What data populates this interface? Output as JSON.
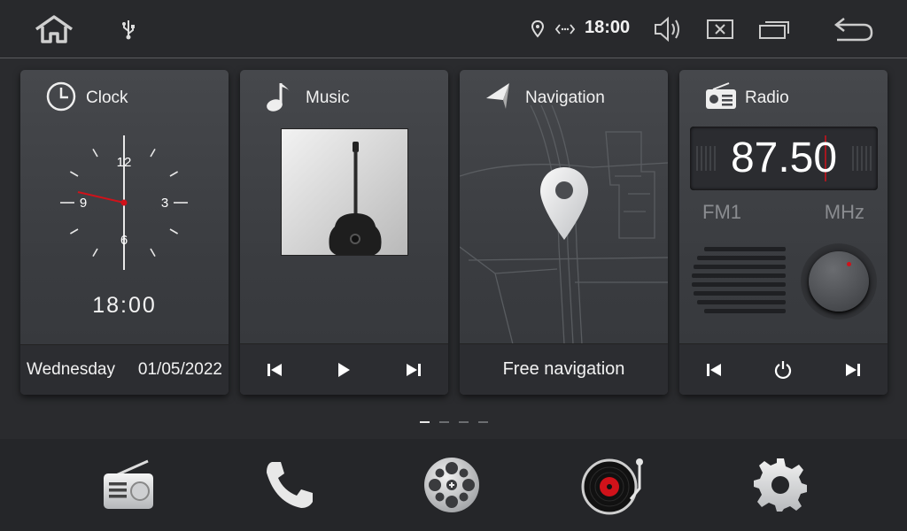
{
  "status_bar": {
    "time": "18:00",
    "icons": [
      "home-icon",
      "usb-icon",
      "location-icon",
      "signal-icon",
      "volume-icon",
      "close-window-icon",
      "recent-apps-icon",
      "back-icon"
    ]
  },
  "widgets": {
    "clock": {
      "title": "Clock",
      "time": "18:00",
      "day": "Wednesday",
      "date": "01/05/2022",
      "dial": {
        "n12": "12",
        "n3": "3",
        "n6": "6",
        "n9": "9"
      }
    },
    "music": {
      "title": "Music",
      "album_art": "guitar-photo"
    },
    "navigation": {
      "title": "Navigation",
      "footer": "Free navigation"
    },
    "radio": {
      "title": "Radio",
      "frequency": "87.50",
      "band": "FM1",
      "unit": "MHz"
    }
  },
  "pager": {
    "pages": 4,
    "active": 1
  },
  "dock": [
    "radio-app-icon",
    "phone-icon",
    "video-reel-icon",
    "music-player-icon",
    "settings-icon"
  ],
  "colors": {
    "accent_red": "#d0121a",
    "background": "#2a2b2e"
  }
}
